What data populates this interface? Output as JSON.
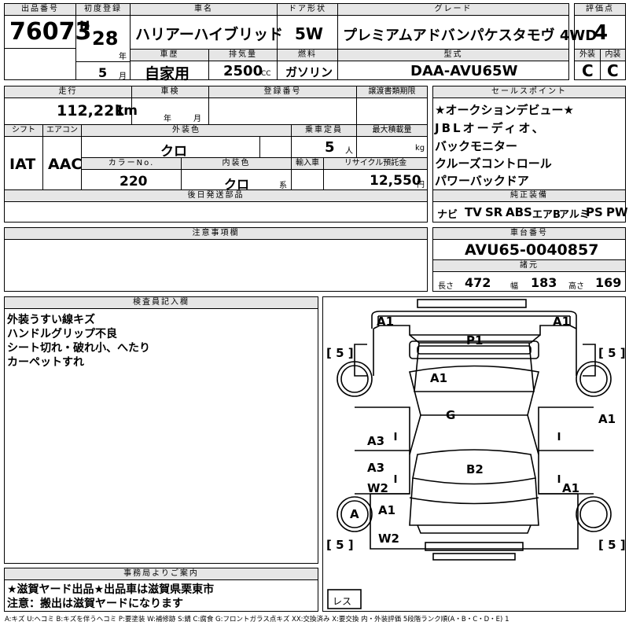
{
  "headers": {
    "lot_no": "出品番号",
    "first_reg": "初度登録",
    "car_name": "車名",
    "door": "ドア形状",
    "grade": "グレード",
    "score": "評価点",
    "history": "車歴",
    "displacement": "排気量",
    "fuel": "燃料",
    "model": "型式",
    "exterior": "外装",
    "interior": "内装",
    "mileage": "走行",
    "inspection": "車検",
    "reg_no": "登録番号",
    "transfer_deadline": "譲渡書類期限",
    "sales_points": "セールスポイント",
    "shift": "シフト",
    "aircon": "エアコン",
    "color": "外装色",
    "capacity": "乗車定員",
    "max_load": "最大積載量",
    "color_no": "カラーNo.",
    "int_color": "内装色",
    "import": "輸入車",
    "recycle": "リサイクル預託金",
    "later_parts": "後日発送部品",
    "equipment": "純正装備",
    "notes": "注意事項欄",
    "chassis": "車台番号",
    "specs": "諸元",
    "inspector": "検査員記入欄",
    "office": "事務局よりご案内"
  },
  "lot_no": "76073",
  "era": "H",
  "year": "28",
  "year_unit": "年",
  "month": "5",
  "month_unit": "月",
  "car_name": "ハリアーハイブリッド",
  "door": "5W",
  "grade": "プレミアムアドバンパケスタモヴ 4WD",
  "score": "4",
  "history": "自家用",
  "displacement": "2500",
  "displacement_unit": "CC",
  "fuel": "ガソリン",
  "model": "DAA-AVU65W",
  "exterior_grade": "C",
  "interior_grade": "C",
  "mileage": "112,221",
  "mileage_unit": "km",
  "insp_year_unit": "年",
  "insp_month_unit": "月",
  "sales_points": [
    "★オークションデビュー★",
    "JBLオーディオ、",
    "バックモニター",
    "クルーズコントロール",
    "パワーバックドア"
  ],
  "shift": "IAT",
  "aircon": "AAC",
  "color": "クロ",
  "capacity": "5",
  "capacity_unit": "人",
  "load_unit": "kg",
  "color_no": "220",
  "int_color": "クロ",
  "int_color_unit": "系",
  "recycle": "12,550",
  "recycle_unit": "円",
  "equipment": [
    "ナビ",
    "TV",
    "SR",
    "ABS",
    "エアB",
    "アルミ",
    "PS",
    "PW"
  ],
  "chassis_no": "AVU65-0040857",
  "specs": {
    "length_label": "長さ",
    "length": "472",
    "width_label": "幅",
    "width": "183",
    "height_label": "高さ",
    "height": "169"
  },
  "inspector_notes": [
    "外装うすい線キズ",
    "ハンドルグリップ不良",
    "シート切れ・破れ小、へたり",
    "カーペットすれ"
  ],
  "office_notes": [
    "★滋賀ヤード出品★出品車は滋賀県栗東市",
    "注意：搬出は滋賀ヤードになります"
  ],
  "diagram": {
    "labels": {
      "a1_front_left": "A1",
      "a1_front_right": "A1",
      "p1": "P1",
      "a1_hood": "A1",
      "g": "G",
      "a3_left": "A3",
      "a1_right_door": "A1",
      "a3_left_rear": "A3",
      "b2": "B2",
      "w2_left": "W2",
      "a1_right_rear": "A1",
      "a_wheel": "A",
      "a1_left_wheel": "A1",
      "w2_left_low": "W2"
    },
    "tire_values": [
      "5",
      "5",
      "5",
      "5"
    ],
    "spare": "レス"
  },
  "legend": "A:キズ U:ヘコミ B:キズを伴うヘコミ P:要塗装 W:補修跡 S:錆 C:腐食 G:フロントガラス点キズ XX:交換済み X:要交換 内・外装評価 5段階ランク順(A・B・C・D・E) 1"
}
